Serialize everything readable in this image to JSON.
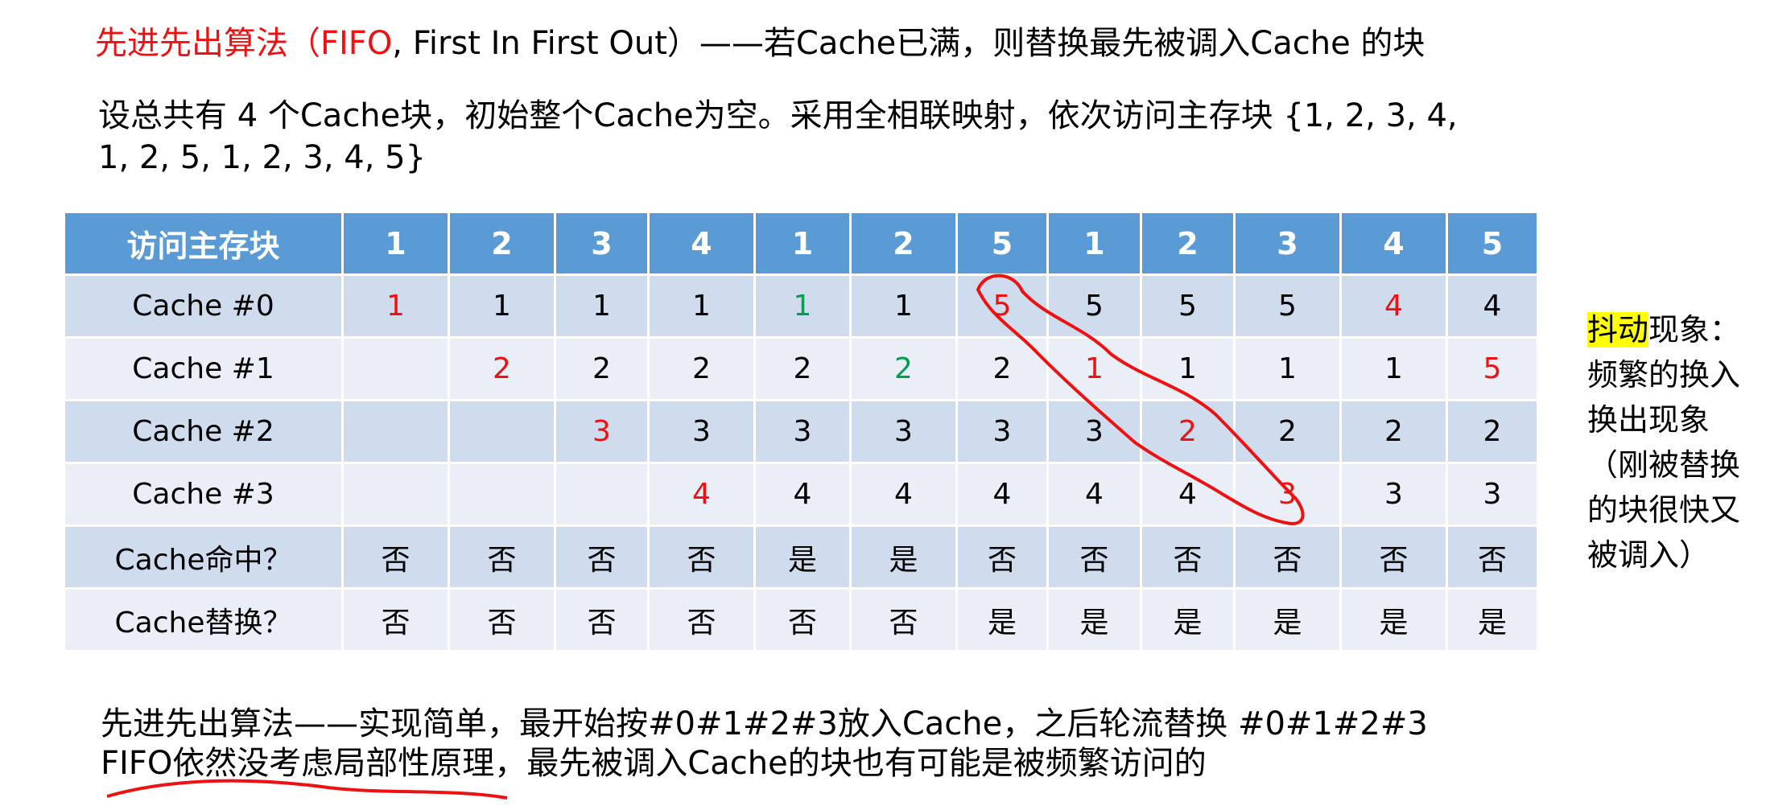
{
  "heading": {
    "title_red": "先进先出算法（",
    "title_fifo": "FIFO",
    "title_rest": ", First In First Out）——若Cache已满，则替换最先被调入Cache 的块"
  },
  "intro": {
    "line1": "设总共有 4 个Cache块，初始整个Cache为空。采用全相联映射，依次访问主存块 {1, 2, 3, 4,",
    "line2": "1, 2, 5, 1, 2, 3, 4, 5}"
  },
  "table": {
    "header_label": "访问主存块",
    "accesses": [
      "1",
      "2",
      "3",
      "4",
      "1",
      "2",
      "5",
      "1",
      "2",
      "3",
      "4",
      "5"
    ],
    "rows": [
      {
        "label": "Cache #0",
        "cells": [
          "1",
          "1",
          "1",
          "1",
          "1",
          "1",
          "5",
          "5",
          "5",
          "5",
          "4",
          "4"
        ],
        "colors": [
          "red",
          "",
          "",
          "",
          "green",
          "",
          "red",
          "",
          "",
          "",
          "red",
          ""
        ]
      },
      {
        "label": "Cache #1",
        "cells": [
          "",
          "2",
          "2",
          "2",
          "2",
          "2",
          "2",
          "1",
          "1",
          "1",
          "1",
          "5"
        ],
        "colors": [
          "",
          "red",
          "",
          "",
          "",
          "green",
          "",
          "red",
          "",
          "",
          "",
          "red"
        ]
      },
      {
        "label": "Cache #2",
        "cells": [
          "",
          "",
          "3",
          "3",
          "3",
          "3",
          "3",
          "3",
          "2",
          "2",
          "2",
          "2"
        ],
        "colors": [
          "",
          "",
          "red",
          "",
          "",
          "",
          "",
          "",
          "red",
          "",
          "",
          ""
        ]
      },
      {
        "label": "Cache #3",
        "cells": [
          "",
          "",
          "",
          "4",
          "4",
          "4",
          "4",
          "4",
          "4",
          "3",
          "3",
          "3"
        ],
        "colors": [
          "",
          "",
          "",
          "red",
          "",
          "",
          "",
          "",
          "",
          "red",
          "",
          ""
        ]
      },
      {
        "label": "Cache命中？",
        "cells": [
          "否",
          "否",
          "否",
          "否",
          "是",
          "是",
          "否",
          "否",
          "否",
          "否",
          "否",
          "否"
        ],
        "colors": [
          "",
          "",
          "",
          "",
          "",
          "",
          "",
          "",
          "",
          "",
          "",
          ""
        ]
      },
      {
        "label": "Cache替换？",
        "cells": [
          "否",
          "否",
          "否",
          "否",
          "否",
          "否",
          "是",
          "是",
          "是",
          "是",
          "是",
          "是"
        ],
        "colors": [
          "",
          "",
          "",
          "",
          "",
          "",
          "",
          "",
          "",
          "",
          "",
          ""
        ]
      }
    ]
  },
  "side_note": {
    "highlight": "抖动",
    "rest": "现象：频繁的换入换出现象（刚被替换的块很快又被调入）"
  },
  "notes": {
    "line1": "先进先出算法——实现简单，最开始按#0#1#2#3放入Cache，之后轮流替换 #0#1#2#3",
    "line2": "FIFO依然没考虑局部性原理，最先被调入Cache的块也有可能是被频繁访问的"
  },
  "colors": {
    "header_bg": "#5b9bd5",
    "row_dark": "#cfdcee",
    "row_light": "#e9eef7",
    "red": "#ee1111",
    "green": "#00a050",
    "highlight": "#ffff00"
  }
}
